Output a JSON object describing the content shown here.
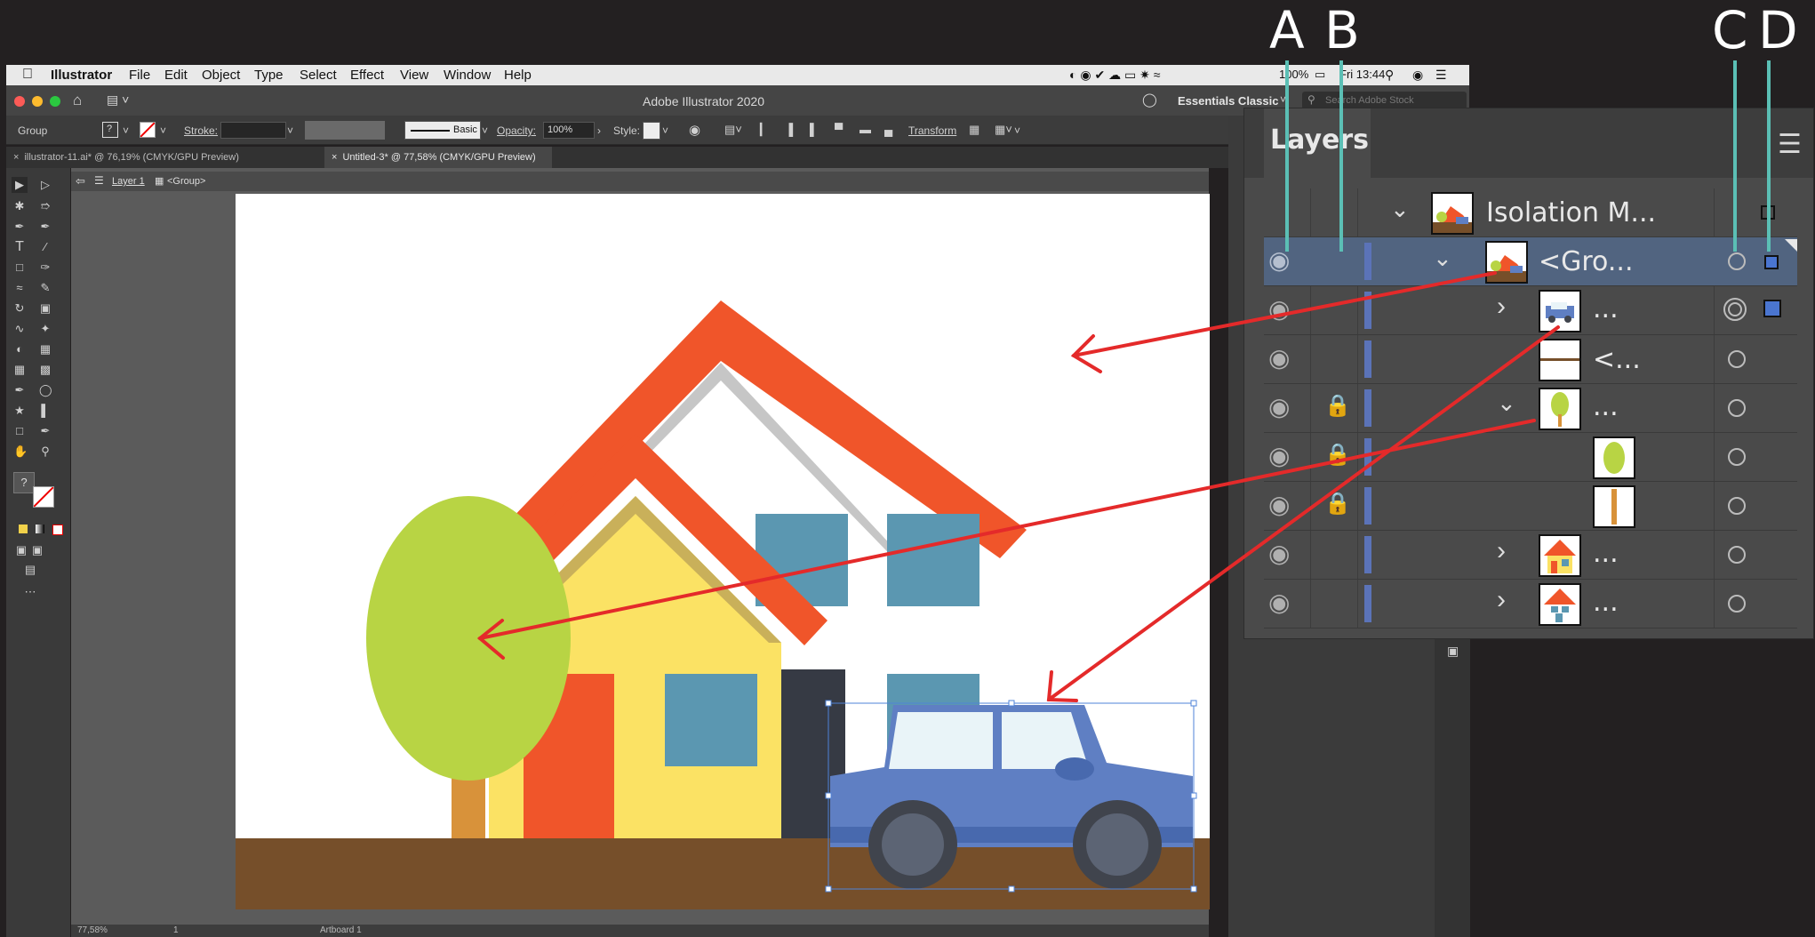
{
  "annotations": {
    "a": "A",
    "b": "B",
    "c": "C",
    "d": "D"
  },
  "menubar": {
    "app": "Illustrator",
    "items": [
      "File",
      "Edit",
      "Object",
      "Type",
      "Select",
      "Effect",
      "View",
      "Window",
      "Help"
    ],
    "battery": "100%",
    "clock": "Fri 13:44"
  },
  "titlebar": {
    "title": "Adobe Illustrator 2020",
    "workspace": "Essentials Classic",
    "search_placeholder": "Search Adobe Stock"
  },
  "controlbar": {
    "selection": "Group",
    "stroke_label": "Stroke:",
    "brush": "Basic",
    "opacity_label": "Opacity:",
    "opacity_value": "100%",
    "style_label": "Style:",
    "transform": "Transform"
  },
  "tabs": [
    {
      "label": "illustrator-11.ai* @ 76,19% (CMYK/GPU Preview)"
    },
    {
      "label": "Untitled-3* @ 77,58% (CMYK/GPU Preview)"
    }
  ],
  "breadcrumb": {
    "layer": "Layer 1",
    "group": "<Group>"
  },
  "statusbar": {
    "zoom": "77,58%",
    "artboard_num": "1",
    "artboard_label": "Artboard 1"
  },
  "layers_panel": {
    "title": "Layers",
    "rows": [
      {
        "name": "Isolation M...",
        "type": "isolation"
      },
      {
        "name": "<Gro...",
        "type": "group-selected"
      },
      {
        "name": "...",
        "type": "car"
      },
      {
        "name": "<...",
        "type": "ground"
      },
      {
        "name": "...",
        "type": "tree"
      },
      {
        "name": "",
        "type": "tree-top"
      },
      {
        "name": "",
        "type": "tree-trunk"
      },
      {
        "name": "...",
        "type": "house1"
      },
      {
        "name": "...",
        "type": "house2"
      }
    ]
  },
  "colors": {
    "annotation_line": "#5bbfb5",
    "arrow": "#e42a2a",
    "roof": "#f0552a",
    "house_yellow": "#fbe264",
    "window_blue": "#5b97b1",
    "tree_green": "#b8d444",
    "ground_brown": "#764f2a",
    "car_blue": "#5f7fc3"
  }
}
